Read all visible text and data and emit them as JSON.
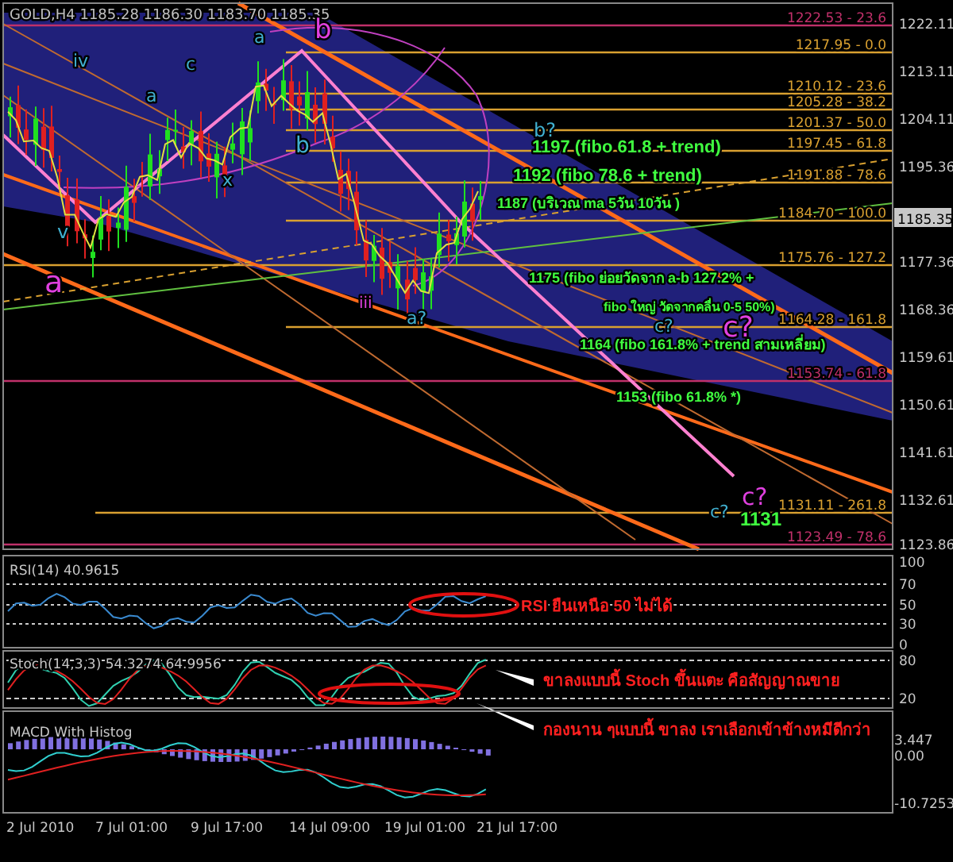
{
  "header": "GOLD,H4  1185.28 1186.30 1183.70 1185.35",
  "price_axis": [
    "1222.11",
    "1213.11",
    "1204.11",
    "1195.36",
    "1177.36",
    "1168.36",
    "1159.61",
    "1150.61",
    "1141.61",
    "1132.61",
    "1123.86"
  ],
  "current_price": "1185.35",
  "fib_levels": [
    {
      "label": "1222.53 - 23.6",
      "color": "#c0306a"
    },
    {
      "label": "1217.95 - 0.0",
      "color": "#d9a030"
    },
    {
      "label": "1210.12 - 23.6",
      "color": "#d9a030"
    },
    {
      "label": "1205.28 - 38.2",
      "color": "#d9a030"
    },
    {
      "label": "1201.37 - 50.0",
      "color": "#d9a030"
    },
    {
      "label": "1197.45 - 61.8",
      "color": "#d9a030"
    },
    {
      "label": "1191.88 - 78.6",
      "color": "#d9a030"
    },
    {
      "label": "1184.70 - 100.0",
      "color": "#d9a030"
    },
    {
      "label": "1175.76 - 127.2",
      "color": "#d9a030"
    },
    {
      "label": "1164.28 - 161.8",
      "color": "#d9a030"
    },
    {
      "label": "1153.74 - 61.8",
      "color": "#c0306a"
    },
    {
      "label": "1131.11 - 261.8",
      "color": "#d9a030"
    },
    {
      "label": "1123.49 - 78.6",
      "color": "#c0306a"
    }
  ],
  "annotations": [
    "1197 (fibo 61.8 + trend)",
    "1192 (fibo 78.6 + trend)",
    "1187 (บริเวณ ma 5วัน 10วัน )",
    "1175 (fibo ย่อยวัดจาก a-b  127.2% +",
    "fibo ใหญ่ วัดจากคลื่น 0-5  50%)",
    "1164 (fibo 161.8% + trend สามเหลี่ยม)",
    "1153 (fibo 61.8% *)",
    "1131"
  ],
  "wave_labels": [
    {
      "text": "b",
      "color": "#e040e0"
    },
    {
      "text": "a",
      "color": "#e040e0"
    },
    {
      "text": "iv",
      "color": "#40b0d0"
    },
    {
      "text": "v",
      "color": "#40b0d0"
    },
    {
      "text": "c",
      "color": "#40b0d0"
    },
    {
      "text": "a",
      "color": "#40b0d0"
    },
    {
      "text": "a",
      "color": "#40b0d0"
    },
    {
      "text": "b",
      "color": "#40b0d0"
    },
    {
      "text": "x",
      "color": "#40b0d0"
    },
    {
      "text": "iii",
      "color": "#e040e0"
    },
    {
      "text": "a?",
      "color": "#40b0d0"
    },
    {
      "text": "b?",
      "color": "#40b0d0"
    },
    {
      "text": "c?",
      "color": "#40b0d0"
    },
    {
      "text": "c?",
      "color": "#e040e0"
    },
    {
      "text": "c?",
      "color": "#40b0d0"
    },
    {
      "text": "c?",
      "color": "#e040e0"
    }
  ],
  "rsi": {
    "title": "RSI(14) 40.9615",
    "scale": [
      "100",
      "70",
      "50",
      "30",
      "0"
    ],
    "note": "RSI ยืนเหนือ 50 ไม่ได้"
  },
  "stoch": {
    "title": "Stoch(14,3,3) 54.3274 64.9956",
    "scale": [
      "80",
      "20"
    ],
    "notes": [
      "ขาลงแบบนี้ Stoch ขึ้นแตะ คือสัญญาณขาย",
      "กองนาน ๆแบบนี้ ขาลง เราเลือกเข้าข้างหมีดีกว่า"
    ]
  },
  "macd": {
    "title": "MACD With Histog",
    "scale": [
      "3.447",
      "0.00",
      "-10.7253"
    ]
  },
  "time_axis": [
    "2 Jul 2010",
    "7 Jul 01:00",
    "9 Jul 17:00",
    "14 Jul 09:00",
    "19 Jul 01:00",
    "21 Jul 17:00"
  ]
}
